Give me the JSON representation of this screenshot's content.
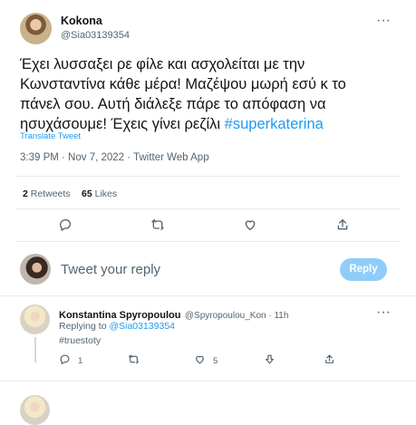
{
  "tweet": {
    "author_name": "Kokona",
    "author_handle": "@Sia03139354",
    "more_label": "···",
    "text_lines": [
      "Έχει λυσσαξει ρε φίλε και ασχολείται με την",
      "Κωνσταντίνα κάθε μέρα! Μαζέψου μωρή εσύ κ το",
      "πάνελ σου. Αυτή διάλεξε πάρε το απόφαση να"
    ],
    "last_line_text": "ησυχάσουμε! Έχεις γίνει ρεζίλι ",
    "hashtag": "#superkaterina",
    "translate_label": "Translate Tweet",
    "timestamp": "3:39 PM · Nov 7, 2022 · Twitter Web App",
    "retweets_count": "2",
    "retweets_label": "Retweets",
    "likes_count": "65",
    "likes_label": "Likes"
  },
  "actions": {
    "icons": [
      "reply-icon",
      "retweet-icon",
      "like-icon",
      "share-icon"
    ]
  },
  "reply_box": {
    "placeholder": "Tweet your reply",
    "button_label": "Reply"
  },
  "reply": {
    "author_name": "Konstantina Spyropoulou",
    "author_handle": "@Spyropoulou_Kon · 11h",
    "more_label": "···",
    "replying_to_label": "Replying to ",
    "replying_to_handle": "@Sia03139354",
    "hashtag": "#truestoty",
    "reply_count": "1",
    "like_count": "5"
  },
  "colors": {
    "accent": "#1d9bf0",
    "reply_button": "#8ecdf8",
    "secondary_text": "#536471",
    "divider": "#e6ecf0"
  }
}
